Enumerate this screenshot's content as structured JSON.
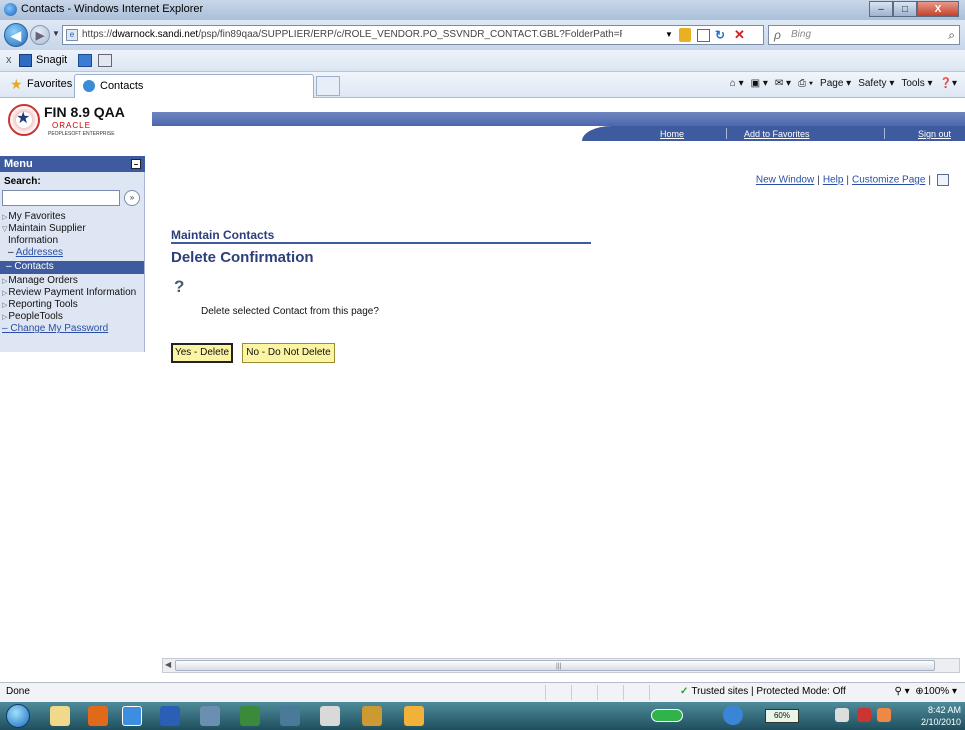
{
  "window": {
    "title": "Contacts - Windows Internet Explorer",
    "min": "–",
    "max": "□",
    "close": "X"
  },
  "address": {
    "url_prefix": "https://",
    "url_host": "dwarnock.sandi.net",
    "url_path": "/psp/fin89qaa/SUPPLIER/ERP/c/ROLE_VENDOR.PO_SSVNDR_CONTACT.GBL?FolderPath=PORTAL_ROOT_OBJECT.",
    "search_placeholder": "Bing"
  },
  "snagit": {
    "label": "Snagit"
  },
  "favorites": {
    "label": "Favorites",
    "tab_label": "Contacts",
    "commands": [
      "Page ▾",
      "Safety ▾",
      "Tools ▾"
    ]
  },
  "ps_header": {
    "logo_title": "FIN 8.9 QAA",
    "logo_oracle": "ORACLE",
    "logo_sub": "PEOPLESOFT ENTERPRISE",
    "nav_links": [
      "Home",
      "Add to Favorites",
      "Sign out"
    ]
  },
  "menu": {
    "title": "Menu",
    "search_label": "Search:",
    "search_value": "",
    "items": [
      {
        "label": "My Favorites"
      },
      {
        "label": "Maintain Supplier"
      },
      {
        "label": "Information"
      },
      {
        "label": "Addresses"
      },
      {
        "label": "Contacts"
      },
      {
        "label": "Manage Orders"
      },
      {
        "label": "Review Payment Information"
      },
      {
        "label": "Reporting Tools"
      },
      {
        "label": "PeopleTools"
      },
      {
        "label": "Change My Password"
      }
    ]
  },
  "toplinks": {
    "new_window": "New Window",
    "help": "Help",
    "customize": "Customize Page"
  },
  "content": {
    "breadcrumb": "Maintain Contacts",
    "heading": "Delete Confirmation",
    "message": "Delete selected Contact from this page?",
    "yes_label": "Yes - Delete",
    "no_label": "No - Do Not Delete"
  },
  "status": {
    "left": "Done",
    "zone": "Trusted sites | Protected Mode: Off",
    "zoom": "100%"
  },
  "taskbar": {
    "battery": "60%",
    "time": "8:42 AM",
    "date": "2/10/2010"
  }
}
